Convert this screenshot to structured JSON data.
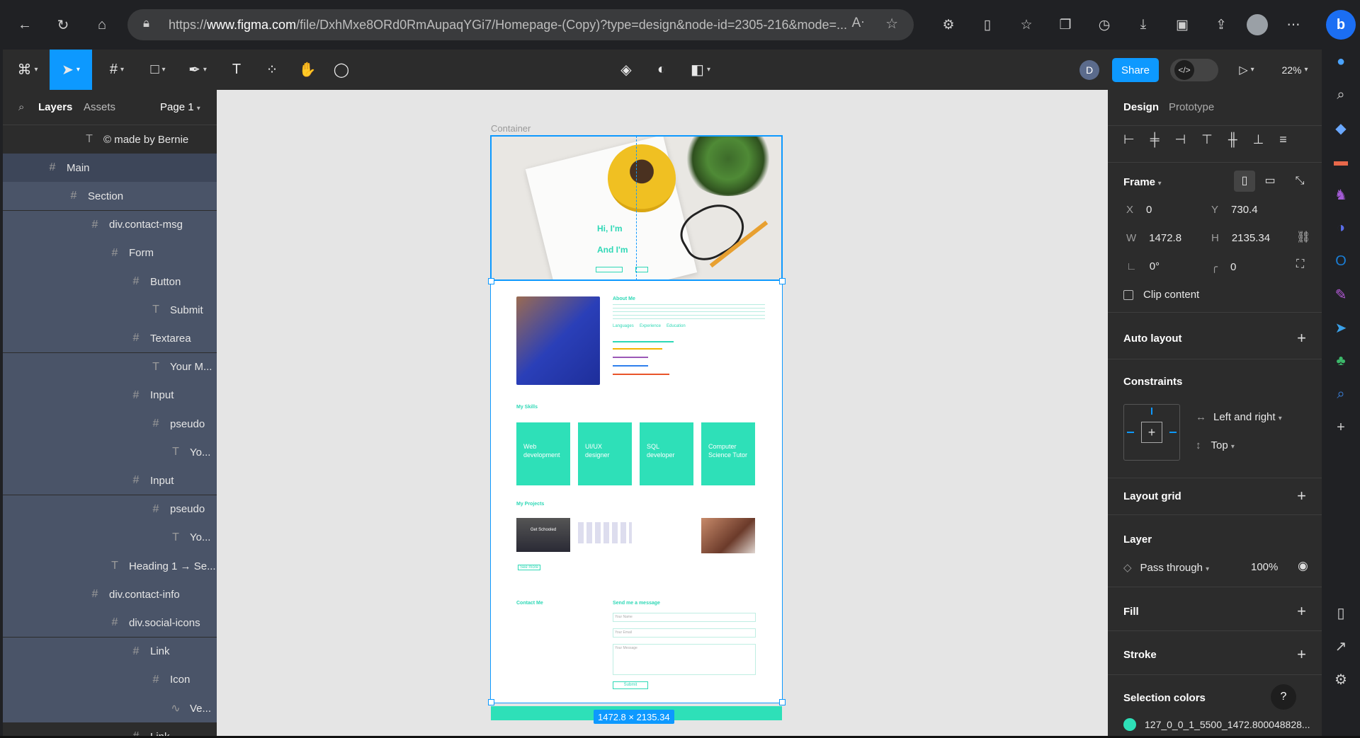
{
  "browser": {
    "url_prefix": "https://",
    "url_host": "www.figma.com",
    "url_path": "/file/DxhMxe8ORd0RmAupaqYGi7/Homepage-(Copy)?type=design&node-id=2305-216&mode=..."
  },
  "toolbar": {
    "share_label": "Share",
    "user_initial": "D",
    "zoom": "22%"
  },
  "layers_panel": {
    "tab_layers": "Layers",
    "tab_assets": "Assets",
    "page": "Page 1",
    "items": [
      {
        "label": "© made by Bernie",
        "icon": "text-icon"
      },
      {
        "label": "Main",
        "icon": "frame-icon"
      },
      {
        "label": "Section",
        "icon": "frame-icon"
      },
      {
        "label": "div.contact-msg",
        "icon": "frame-icon"
      },
      {
        "label": "Form",
        "icon": "frame-icon"
      },
      {
        "label": "Button",
        "icon": "frame-icon"
      },
      {
        "label": "Submit",
        "icon": "text-icon"
      },
      {
        "label": "Textarea",
        "icon": "frame-icon"
      },
      {
        "label": "Your M...",
        "icon": "text-icon"
      },
      {
        "label": "Input",
        "icon": "frame-icon"
      },
      {
        "label": "pseudo",
        "icon": "frame-icon"
      },
      {
        "label": "Yo...",
        "icon": "text-icon"
      },
      {
        "label": "Input",
        "icon": "frame-icon"
      },
      {
        "label": "pseudo",
        "icon": "frame-icon"
      },
      {
        "label": "Yo...",
        "icon": "text-icon"
      },
      {
        "label": "Heading 1 → Se...",
        "icon": "text-icon"
      },
      {
        "label": "div.contact-info",
        "icon": "frame-icon"
      },
      {
        "label": "div.social-icons",
        "icon": "frame-icon"
      },
      {
        "label": "Link",
        "icon": "frame-icon"
      },
      {
        "label": "Icon",
        "icon": "frame-icon"
      },
      {
        "label": "Ve...",
        "icon": "vector-icon"
      },
      {
        "label": "Link",
        "icon": "frame-icon"
      }
    ]
  },
  "canvas": {
    "frame_label": "Container",
    "dimensions": "1472.8 × 2135.34",
    "design": {
      "hero_hi": "Hi, I'm",
      "hero_am": "And I'm",
      "about_title": "About Me",
      "about_tabs": [
        "Languages",
        "Experience",
        "Education"
      ],
      "skills_title": "My Skills",
      "skills": [
        "Web development",
        "UI/UX designer",
        "SQL developer",
        "Computer Science Tutor"
      ],
      "projects_title": "My Projects",
      "project_name": "Get Schooled",
      "see_more": "See more",
      "contact_title": "Contact Me",
      "message_title": "Send me a message",
      "field_name": "Your Name",
      "field_email": "Your Email",
      "field_message": "Your Message",
      "submit": "Submit"
    }
  },
  "design_panel": {
    "tab_design": "Design",
    "tab_prototype": "Prototype",
    "frame_label": "Frame",
    "x_label": "X",
    "x": "0",
    "y_label": "Y",
    "y": "730.4",
    "w_label": "W",
    "w": "1472.8",
    "h_label": "H",
    "h": "2135.34",
    "rotation": "0°",
    "radius": "0",
    "clip_content": "Clip content",
    "auto_layout": "Auto layout",
    "constraints": "Constraints",
    "constraint_h": "Left and right",
    "constraint_v": "Top",
    "layout_grid": "Layout grid",
    "layer": "Layer",
    "blend": "Pass through",
    "opacity": "100%",
    "fill": "Fill",
    "stroke": "Stroke",
    "selection_colors": "Selection colors",
    "color_name": "127_0_0_1_5500_1472.800048828...",
    "color_swatch": "#2ee0b8",
    "help": "?"
  }
}
